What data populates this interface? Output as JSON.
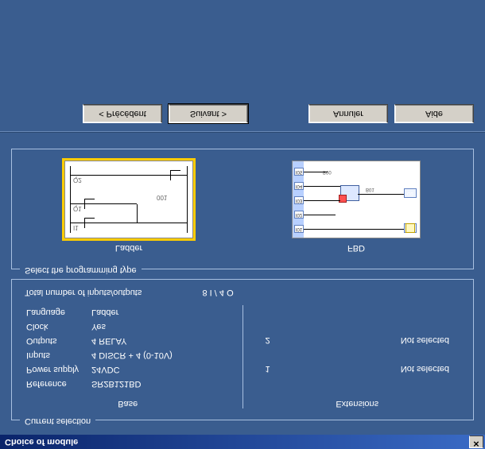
{
  "window": {
    "title": "Choice of module",
    "close_glyph": "✕"
  },
  "groups": {
    "current": "Current selection",
    "progtype": "Select the programming type"
  },
  "headers": {
    "base": "Base",
    "extensions": "Extensions"
  },
  "base": {
    "reference_k": "Reference",
    "reference_v": "SR2B121BD",
    "power_k": "Power supply",
    "power_v": "24VDC",
    "inputs_k": "Inputs",
    "inputs_v": "4 DISCR + 4 (0-10V)",
    "outputs_k": "Outputs",
    "outputs_v": "4 RELAY",
    "clock_k": "Clock",
    "clock_v": "Yes",
    "lang_k": "Language",
    "lang_v": "Ladder"
  },
  "ext": {
    "slot1_k": "1",
    "slot1_v": "Not selected",
    "slot2_k": "2",
    "slot2_v": "Not selected"
  },
  "totals": {
    "label": "Total number of inputs/outputs",
    "value": "8 I / 4 O"
  },
  "options": {
    "ladder": "Ladder",
    "fbd": "FBD",
    "selected": "ladder"
  },
  "buttons": {
    "prev": "< Précédent",
    "next": "Suivant >",
    "cancel": "Annuler",
    "help": "Aide"
  }
}
